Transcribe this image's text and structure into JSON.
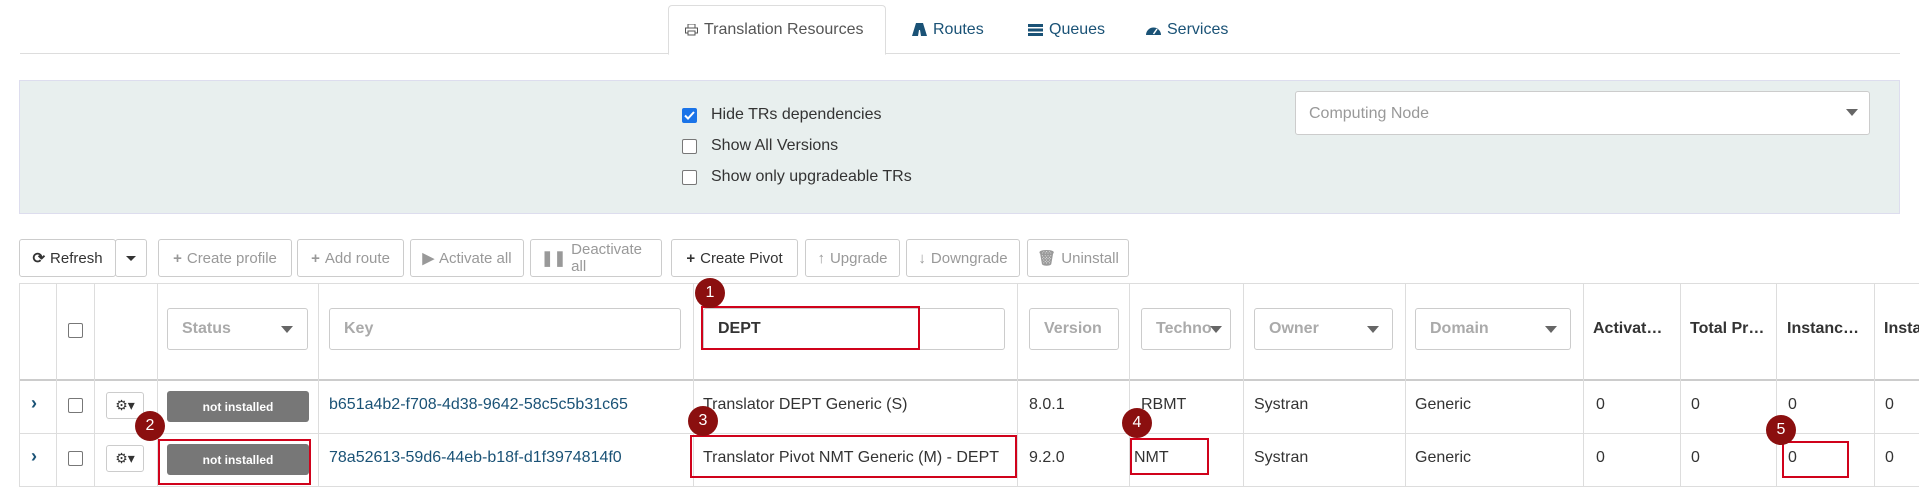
{
  "tabs": [
    {
      "label": "Translation Resources",
      "icon": "printer-icon",
      "active": true
    },
    {
      "label": "Routes",
      "icon": "road-icon",
      "active": false
    },
    {
      "label": "Queues",
      "icon": "list-icon",
      "active": false
    },
    {
      "label": "Services",
      "icon": "dashboard-icon",
      "active": false
    }
  ],
  "filters": {
    "hide_dependencies": {
      "label": "Hide TRs dependencies",
      "checked": true
    },
    "show_all_versions": {
      "label": "Show All Versions",
      "checked": false
    },
    "show_upgradeable": {
      "label": "Show only upgradeable TRs",
      "checked": false
    },
    "computing_node_placeholder": "Computing Node"
  },
  "toolbar": {
    "refresh": "Refresh",
    "create_profile": "Create profile",
    "add_route": "Add route",
    "activate_all": "Activate all",
    "deactivate_all": "Deactivate all",
    "create_pivot": "Create Pivot",
    "upgrade": "Upgrade",
    "downgrade": "Downgrade",
    "uninstall": "Uninstall"
  },
  "columns": {
    "status": "Status",
    "key": "Key",
    "name_filter_value": "DEPT",
    "version": "Version",
    "techno": "Techno",
    "owner": "Owner",
    "domain": "Domain",
    "activated": "Activat…",
    "total_profiles": "Total Pr…",
    "instances": "Instanc…",
    "insta": "Insta"
  },
  "rows": [
    {
      "status": "not installed",
      "key": "b651a4b2-f708-4d38-9642-58c5c5b31c65",
      "name": "Translator DEPT Generic (S)",
      "version": "8.0.1",
      "techno": "RBMT",
      "owner": "Systran",
      "domain": "Generic",
      "activated": "0",
      "total": "0",
      "instances": "0",
      "insta": "0"
    },
    {
      "status": "not installed",
      "key": "78a52613-59d6-44eb-b18f-d1f3974814f0",
      "name": "Translator Pivot NMT Generic (M) - DEPT",
      "version": "9.2.0",
      "techno": "NMT",
      "owner": "Systran",
      "domain": "Generic",
      "activated": "0",
      "total": "0",
      "instances": "0",
      "insta": "0"
    }
  ],
  "annotations": [
    "1",
    "2",
    "3",
    "4",
    "5"
  ],
  "colors": {
    "accent": "#1a5276",
    "highlight": "#d0021b",
    "marker": "#8b0f0f",
    "badge": "#777777"
  }
}
